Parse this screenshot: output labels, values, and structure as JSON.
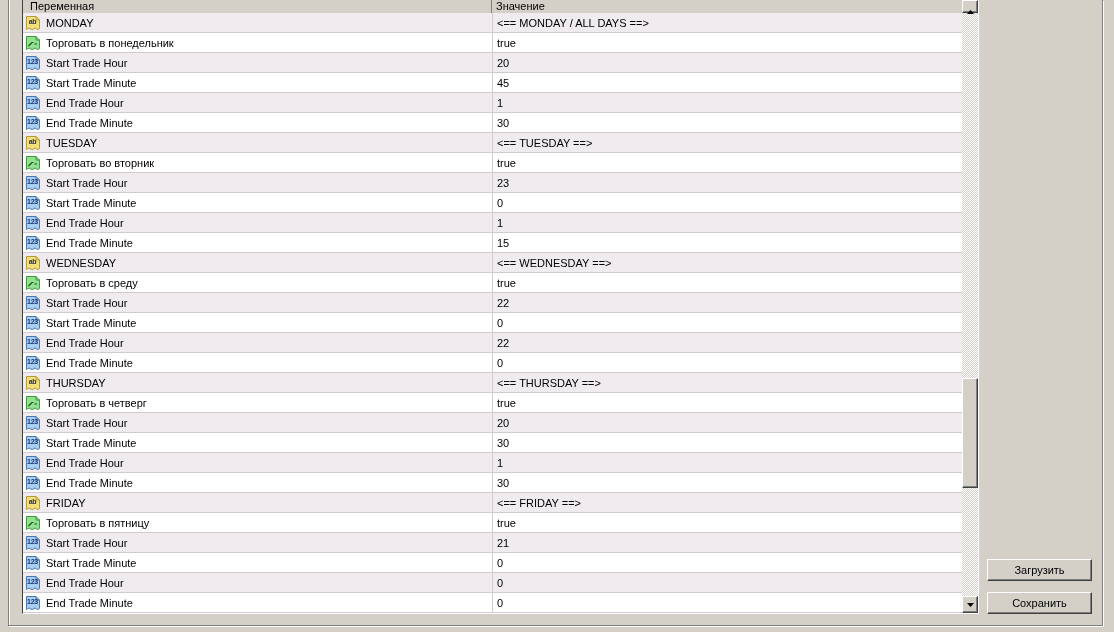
{
  "table": {
    "columns": [
      {
        "label": "Переменная"
      },
      {
        "label": "Значение"
      }
    ],
    "rows": [
      {
        "kind": "string",
        "icon_label": "ab",
        "name": "MONDAY",
        "value": "<== MONDAY / ALL DAYS ==>"
      },
      {
        "kind": "bool",
        "name": "Торговать в понедельник",
        "value": "true"
      },
      {
        "kind": "int",
        "icon_label": "123",
        "name": "Start Trade Hour",
        "value": "20"
      },
      {
        "kind": "int",
        "icon_label": "123",
        "name": "Start Trade Minute",
        "value": "45"
      },
      {
        "kind": "int",
        "icon_label": "123",
        "name": "End Trade Hour",
        "value": "1"
      },
      {
        "kind": "int",
        "icon_label": "123",
        "name": "End Trade Minute",
        "value": "30"
      },
      {
        "kind": "string",
        "icon_label": "ab",
        "name": "TUESDAY",
        "value": "<== TUESDAY ==>"
      },
      {
        "kind": "bool",
        "name": "Торговать во вторник",
        "value": "true"
      },
      {
        "kind": "int",
        "icon_label": "123",
        "name": "Start Trade Hour",
        "value": "23"
      },
      {
        "kind": "int",
        "icon_label": "123",
        "name": "Start Trade Minute",
        "value": "0"
      },
      {
        "kind": "int",
        "icon_label": "123",
        "name": "End Trade Hour",
        "value": "1"
      },
      {
        "kind": "int",
        "icon_label": "123",
        "name": "End Trade Minute",
        "value": "15"
      },
      {
        "kind": "string",
        "icon_label": "ab",
        "name": "WEDNESDAY",
        "value": "<== WEDNESDAY ==>"
      },
      {
        "kind": "bool",
        "name": "Торговать в среду",
        "value": "true"
      },
      {
        "kind": "int",
        "icon_label": "123",
        "name": "Start Trade Hour",
        "value": "22"
      },
      {
        "kind": "int",
        "icon_label": "123",
        "name": "Start Trade Minute",
        "value": "0"
      },
      {
        "kind": "int",
        "icon_label": "123",
        "name": "End Trade Hour",
        "value": "22"
      },
      {
        "kind": "int",
        "icon_label": "123",
        "name": "End Trade Minute",
        "value": "0"
      },
      {
        "kind": "string",
        "icon_label": "ab",
        "name": "THURSDAY",
        "value": "<== THURSDAY ==>"
      },
      {
        "kind": "bool",
        "name": "Торговать в четверг",
        "value": "true"
      },
      {
        "kind": "int",
        "icon_label": "123",
        "name": "Start Trade Hour",
        "value": "20"
      },
      {
        "kind": "int",
        "icon_label": "123",
        "name": "Start Trade Minute",
        "value": "30"
      },
      {
        "kind": "int",
        "icon_label": "123",
        "name": "End Trade Hour",
        "value": "1"
      },
      {
        "kind": "int",
        "icon_label": "123",
        "name": "End Trade Minute",
        "value": "30"
      },
      {
        "kind": "string",
        "icon_label": "ab",
        "name": "FRIDAY",
        "value": "<== FRIDAY ==>"
      },
      {
        "kind": "bool",
        "name": "Торговать в пятницу",
        "value": "true"
      },
      {
        "kind": "int",
        "icon_label": "123",
        "name": "Start Trade Hour",
        "value": "21"
      },
      {
        "kind": "int",
        "icon_label": "123",
        "name": "Start Trade Minute",
        "value": "0"
      },
      {
        "kind": "int",
        "icon_label": "123",
        "name": "End Trade Hour",
        "value": "0"
      },
      {
        "kind": "int",
        "icon_label": "123",
        "name": "End Trade Minute",
        "value": "0"
      }
    ]
  },
  "buttons": [
    {
      "label": "Загрузить"
    },
    {
      "label": "Сохранить"
    }
  ]
}
